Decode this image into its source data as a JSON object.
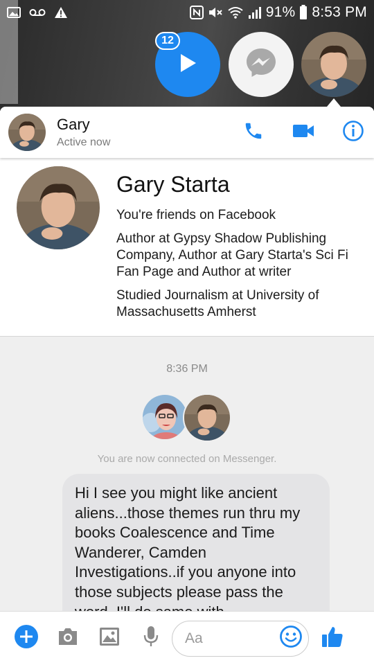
{
  "status_bar": {
    "battery": "91%",
    "time": "8:53 PM"
  },
  "chat_heads": {
    "badge_count": "12"
  },
  "header": {
    "name": "Gary",
    "status": "Active now"
  },
  "profile": {
    "name": "Gary Starta",
    "friends": "You're friends on Facebook",
    "work": "Author at Gypsy Shadow Publishing Company, Author at Gary Starta's Sci Fi Fan Page and Author at writer",
    "education": "Studied Journalism at University of Massachusetts Amherst"
  },
  "conversation": {
    "timestamp": "8:36 PM",
    "connected_notice": "You are now connected on Messenger.",
    "message": "Hi I see you might like ancient aliens...those themes run thru my books Coalescence and Time Wanderer, Camden Investigations..if you anyone into those subjects please pass the word..I'll do same with"
  },
  "composer": {
    "placeholder": "Aa"
  },
  "colors": {
    "accent": "#1e88f0",
    "bubble": "#e4e4e6",
    "header_bg": "#ffffff"
  },
  "icons": [
    "gallery-icon",
    "voicemail-icon",
    "warning-icon",
    "nfc-icon",
    "mute-icon",
    "wifi-icon",
    "signal-icon",
    "battery-icon",
    "play-icon",
    "messenger-icon",
    "phone-icon",
    "video-icon",
    "info-icon",
    "plus-icon",
    "camera-icon",
    "image-icon",
    "mic-icon",
    "emoji-icon",
    "like-icon"
  ]
}
